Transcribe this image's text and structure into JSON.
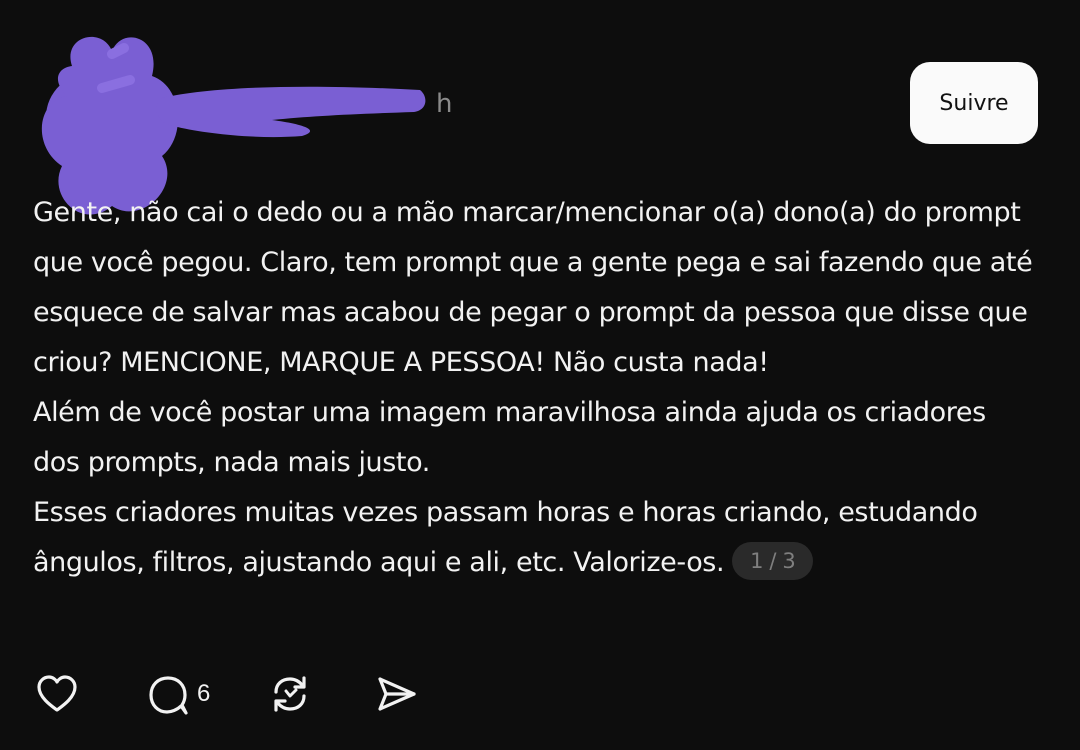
{
  "header": {
    "timestamp": "h",
    "follow_label": "Suivre"
  },
  "post": {
    "paragraphs": [
      "Gente, não cai o dedo ou a mão marcar/mencionar o(a) dono(a) do prompt que você pegou. Claro, tem prompt que a gente pega e sai fazendo que até esquece de salvar mas acabou de pegar o prompt da pessoa que disse que criou? MENCIONE, MARQUE A PESSOA! Não custa nada!",
      "Além de você postar uma imagem maravilhosa ainda ajuda os criadores dos prompts, nada mais justo.",
      "Esses criadores muitas vezes passam horas e horas criando, estudando ângulos, filtros, ajustando aqui e ali, etc. Valorize-os."
    ],
    "page_indicator": "1 / 3"
  },
  "actions": {
    "like_icon": "heart-icon",
    "comment_icon": "comment-bubble-icon",
    "comment_count": "6",
    "repost_icon": "repost-icon",
    "share_icon": "send-icon"
  },
  "colors": {
    "background": "#0d0d0d",
    "redaction_scribble": "#7a5fd3",
    "follow_button": "#fafafa"
  }
}
